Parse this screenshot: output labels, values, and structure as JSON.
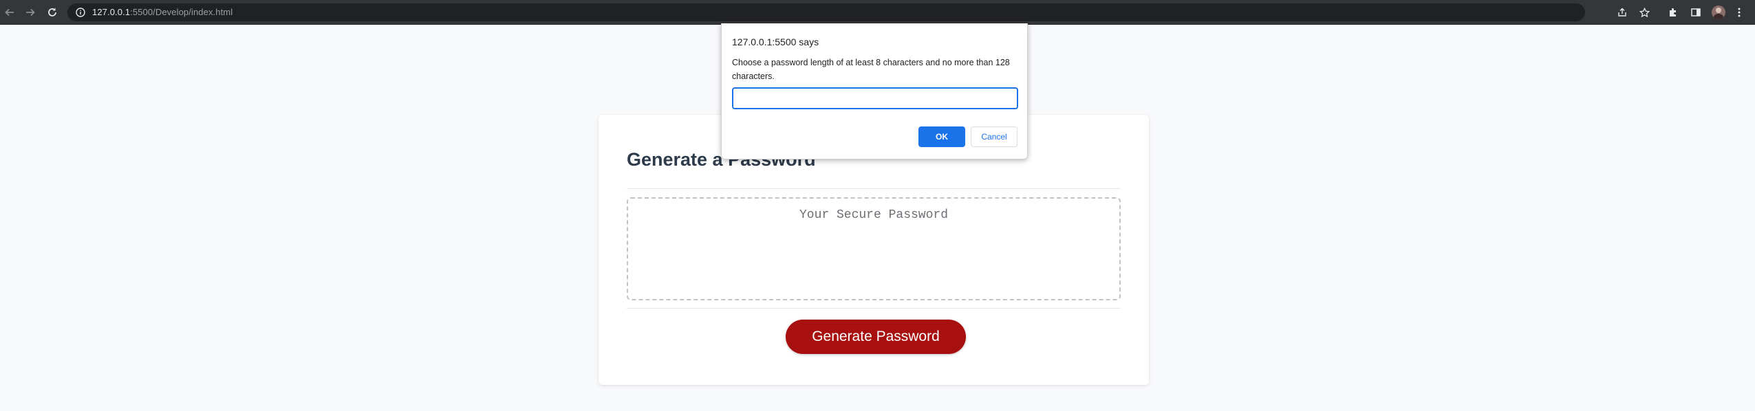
{
  "browser": {
    "url_host": "127.0.0.1",
    "url_rest": ":5500/Develop/index.html"
  },
  "page": {
    "title": "Generate a Password",
    "password_placeholder": "Your Secure Password",
    "generate_button_label": "Generate Password"
  },
  "dialog": {
    "origin": "127.0.0.1:5500 says",
    "message": "Choose a password length of at least 8 characters and no more than 128 characters.",
    "input_value": "",
    "ok_label": "OK",
    "cancel_label": "Cancel"
  },
  "colors": {
    "accent_button": "#a80f0f",
    "dialog_primary": "#1a73e8",
    "page_background": "#f8f9fb"
  },
  "icons": [
    "back-arrow-icon",
    "forward-arrow-icon",
    "reload-icon",
    "site-info-icon",
    "share-icon",
    "bookmark-star-icon",
    "extensions-puzzle-icon",
    "side-panel-icon",
    "menu-kebab-icon"
  ]
}
